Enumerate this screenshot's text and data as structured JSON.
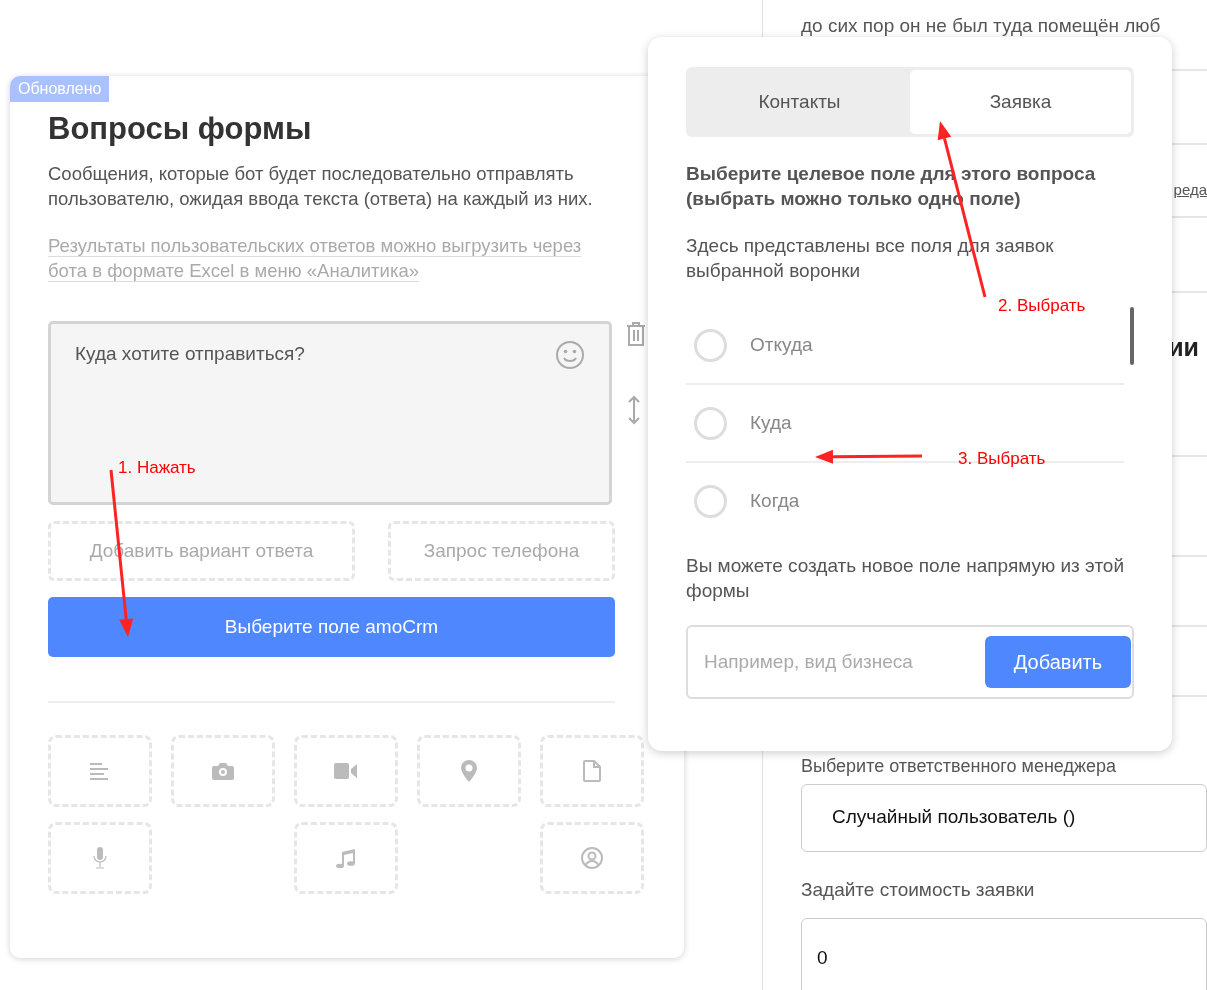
{
  "background_panel": {
    "top_text": "до сих пор он не был туда помещён люб",
    "link_fragment": "реда",
    "heading_fragment": "ии",
    "manager_label": "Выберите ответственного менеджера",
    "manager_select": "Случайный пользователь ()",
    "cost_label": "Задайте стоимость заявки",
    "cost_value": "0"
  },
  "form_card": {
    "badge": "Обновлено",
    "title": "Вопросы формы",
    "description": "Сообщения, которые бот будет последовательно отправлять пользователю, ожидая ввода текста (ответа) на каждый из них.",
    "export_note": "Результаты пользовательских ответов можно выгрузить через бота в формате Excel в меню «Аналитика»",
    "question": {
      "text": "Куда хотите отправиться?"
    },
    "answer_buttons": [
      "Добавить вариант ответа",
      "Запрос телефона"
    ],
    "primary_button": "Выберите поле amoCrm",
    "attachment_rows": [
      [
        {
          "kind": "text"
        },
        {
          "kind": "photo"
        },
        {
          "kind": "video"
        },
        {
          "kind": "location"
        },
        {
          "kind": "file"
        }
      ],
      [
        {
          "kind": "voice"
        },
        {
          "kind": "music"
        },
        {
          "kind": "contact"
        }
      ]
    ]
  },
  "popover": {
    "tabs": [
      {
        "label": "Контакты",
        "selected": false
      },
      {
        "label": "Заявка",
        "selected": true
      }
    ],
    "heading": "Выберите целевое поле для этого вопроса (выбрать можно только одно поле)",
    "hint": "Здесь представлены все поля для заявок выбранной воронки",
    "fields": [
      {
        "label": "Откуда",
        "selected": false
      },
      {
        "label": "Куда",
        "selected": false
      },
      {
        "label": "Когда",
        "selected": false
      }
    ],
    "create_hint": "Вы можете создать новое поле напрямую из этой формы",
    "new_field": {
      "placeholder": "Например, вид бизнеса"
    },
    "add_button": "Добавить"
  },
  "annotations": [
    {
      "text": "1. Нажать"
    },
    {
      "text": "2. Выбрать"
    },
    {
      "text": "3. Выбрать"
    }
  ]
}
